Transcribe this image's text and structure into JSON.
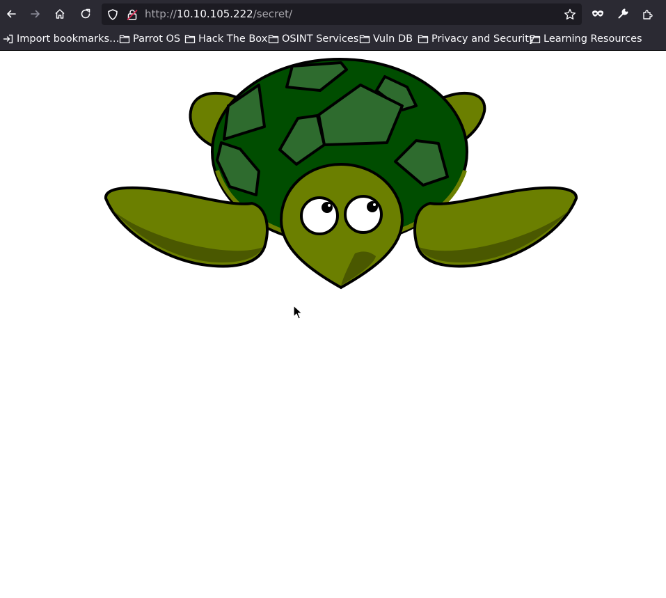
{
  "browser": {
    "url": {
      "scheme": "http://",
      "host": "10.10.105.222",
      "path": "/secret/"
    },
    "toolbar_icons": [
      "back-icon",
      "forward-icon",
      "home-icon",
      "reload-icon",
      "shield-icon",
      "insecure-lock-icon",
      "star-icon",
      "mask-icon",
      "wrench-icon",
      "extensions-icon"
    ],
    "bookmarks": [
      {
        "label": "Import bookmarks…",
        "icon": "import-icon"
      },
      {
        "label": "Parrot OS",
        "icon": "folder-icon"
      },
      {
        "label": "Hack The Box",
        "icon": "folder-icon"
      },
      {
        "label": "OSINT Services",
        "icon": "folder-icon"
      },
      {
        "label": "Vuln DB",
        "icon": "folder-icon"
      },
      {
        "label": "Privacy and Security",
        "icon": "folder-icon"
      },
      {
        "label": "Learning Resources",
        "icon": "folder-icon"
      }
    ]
  },
  "page": {
    "image": "turtle-image",
    "colors": {
      "shell": "#004d00",
      "shell_patch": "#2e6b2e",
      "skin": "#6b7f00",
      "skin_shade": "#4a5800",
      "outline": "#000000"
    }
  }
}
